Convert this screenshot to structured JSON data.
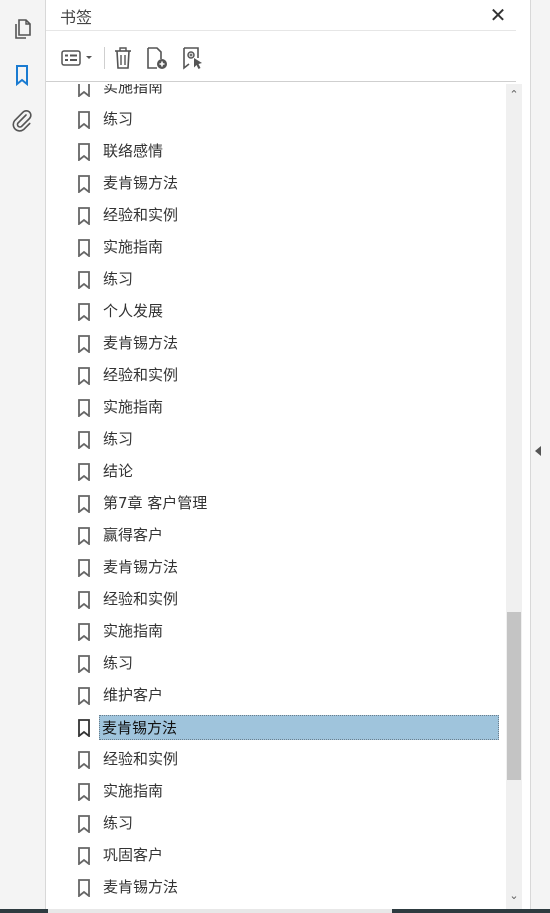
{
  "panel": {
    "title": "书签",
    "close_symbol": "✕"
  },
  "left_toolbar": [
    {
      "icon": "pages-icon",
      "active": false
    },
    {
      "icon": "bookmark-icon",
      "active": true
    },
    {
      "icon": "attachment-icon",
      "active": false
    }
  ],
  "toolbar": {
    "options": "options-menu-icon",
    "delete": "trash-icon",
    "new": "new-bookmark-icon",
    "from_selection": "bookmark-from-selection-icon"
  },
  "colors": {
    "active_icon": "#1a7bd1",
    "selected_bg": "#9fc4dc"
  },
  "bookmarks": [
    {
      "label": "实施指南"
    },
    {
      "label": "练习"
    },
    {
      "label": "联络感情"
    },
    {
      "label": "麦肯锡方法"
    },
    {
      "label": "经验和实例"
    },
    {
      "label": "实施指南"
    },
    {
      "label": "练习"
    },
    {
      "label": "个人发展"
    },
    {
      "label": "麦肯锡方法"
    },
    {
      "label": "经验和实例"
    },
    {
      "label": "实施指南"
    },
    {
      "label": "练习"
    },
    {
      "label": "结论"
    },
    {
      "label": "第7章 客户管理"
    },
    {
      "label": "赢得客户"
    },
    {
      "label": "麦肯锡方法"
    },
    {
      "label": "经验和实例"
    },
    {
      "label": "实施指南"
    },
    {
      "label": "练习"
    },
    {
      "label": "维护客户"
    },
    {
      "label": "麦肯锡方法",
      "selected": true
    },
    {
      "label": "经验和实例"
    },
    {
      "label": "实施指南"
    },
    {
      "label": "练习"
    },
    {
      "label": "巩固客户"
    },
    {
      "label": "麦肯锡方法"
    }
  ],
  "scrollbar": {
    "up_symbol": "⌃",
    "down_symbol": "⌄"
  }
}
